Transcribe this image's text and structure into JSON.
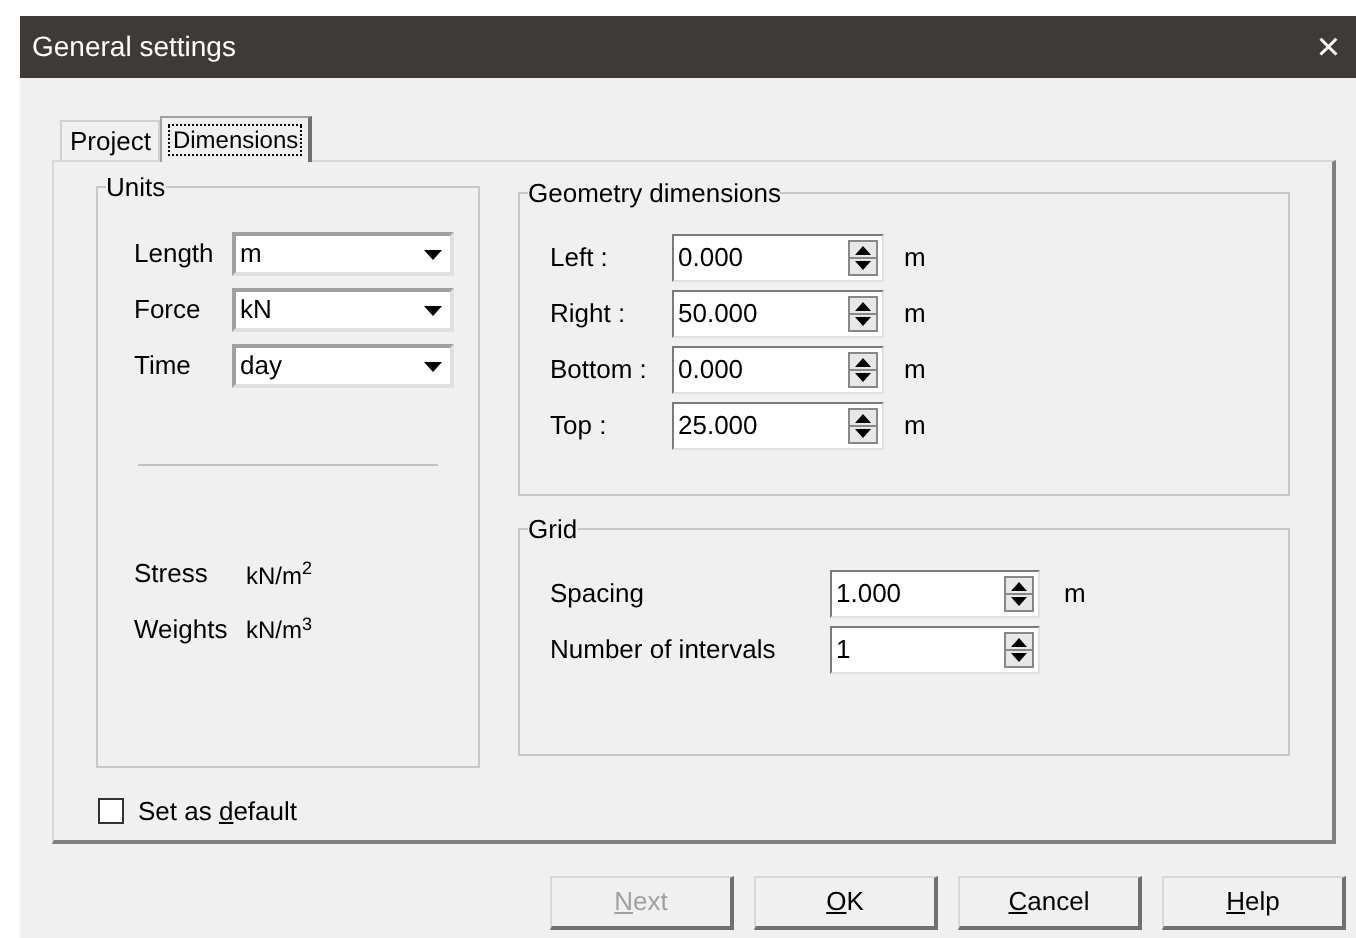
{
  "window": {
    "title": "General settings",
    "close": "×"
  },
  "tabs": [
    {
      "label": "Project",
      "selected": false
    },
    {
      "label": "Dimensions",
      "selected": true
    }
  ],
  "units": {
    "title": "Units",
    "fields": [
      {
        "label": "Length",
        "value": "m"
      },
      {
        "label": "Force",
        "value": "kN"
      },
      {
        "label": "Time",
        "value": "day"
      }
    ],
    "derived": [
      {
        "label": "Stress",
        "value": "kN/m$^{2}$"
      },
      {
        "label": "Weights",
        "value": "kN/m$^{3}$"
      }
    ]
  },
  "geometry": {
    "title": "Geometry dimensions",
    "fields": [
      {
        "label": "Left :",
        "value": "0.000",
        "unit": "m"
      },
      {
        "label": "Right :",
        "value": "50.000",
        "unit": "m"
      },
      {
        "label": "Bottom :",
        "value": "0.000",
        "unit": "m"
      },
      {
        "label": "Top :",
        "value": "25.000",
        "unit": "m"
      }
    ]
  },
  "grid": {
    "title": "Grid",
    "fields": [
      {
        "label": "Spacing",
        "value": "1.000",
        "unit": "m"
      },
      {
        "label": "Number of intervals",
        "value": "1"
      }
    ]
  },
  "set_default": {
    "before": "Set as ",
    "key": "d",
    "after": "efault",
    "checked": false
  },
  "buttons": [
    {
      "key": "N",
      "rest": "ext",
      "disabled": true
    },
    {
      "key": "O",
      "rest": "K",
      "disabled": false
    },
    {
      "key": "C",
      "rest": "ancel",
      "disabled": false
    },
    {
      "key": "H",
      "rest": "elp",
      "disabled": false
    }
  ]
}
